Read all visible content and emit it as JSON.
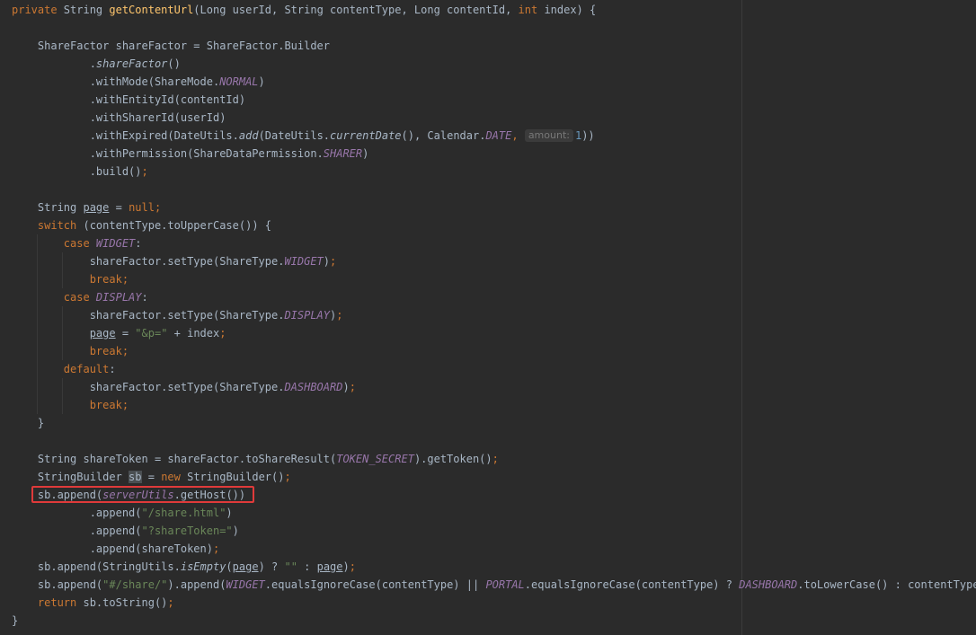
{
  "editor": {
    "theme_colors": {
      "background": "#2b2b2b",
      "keyword": "#cc7832",
      "method_declaration": "#ffc66d",
      "identifier": "#a9b7c6",
      "constant": "#9876aa",
      "string": "#6a8759",
      "number": "#6897bb",
      "highlight_box": "#e03a3a"
    },
    "highlighted_line": "sb.append(serverUtils.getHost())",
    "inlay_hint": "amount:",
    "lines": [
      [
        [
          "kw",
          "private "
        ],
        [
          "pl",
          "String "
        ],
        [
          "mt",
          "getContentUrl"
        ],
        [
          "pl",
          "(Long userId, String contentType, Long contentId, "
        ],
        [
          "kw",
          "int "
        ],
        [
          "pl",
          "index) {"
        ]
      ],
      [],
      [
        [
          "pl",
          "    ShareFactor shareFactor = ShareFactor."
        ],
        [
          "pl",
          "Builder"
        ]
      ],
      [
        [
          "pl",
          "            ."
        ],
        [
          "sc",
          "shareFactor"
        ],
        [
          "pl",
          "()"
        ]
      ],
      [
        [
          "pl",
          "            .withMode(ShareMode."
        ],
        [
          "st",
          "NORMAL"
        ],
        [
          "pl",
          ")"
        ]
      ],
      [
        [
          "pl",
          "            .withEntityId(contentId)"
        ]
      ],
      [
        [
          "pl",
          "            .withSharerId(userId)"
        ]
      ],
      [
        [
          "pl",
          "            .withExpired(DateUtils."
        ],
        [
          "sc",
          "add"
        ],
        [
          "pl",
          "(DateUtils."
        ],
        [
          "sc",
          "currentDate"
        ],
        [
          "pl",
          "(), Calendar."
        ],
        [
          "st",
          "DATE"
        ],
        [
          "pu",
          ", "
        ],
        [
          "hint",
          "amount:"
        ],
        [
          "nu",
          "1"
        ],
        [
          "pl",
          "))"
        ]
      ],
      [
        [
          "pl",
          "            .withPermission(ShareDataPermission."
        ],
        [
          "st",
          "SHARER"
        ],
        [
          "pl",
          ")"
        ]
      ],
      [
        [
          "pl",
          "            .build()"
        ],
        [
          "pu",
          ";"
        ]
      ],
      [],
      [
        [
          "pl",
          "    String "
        ],
        [
          "ul",
          "page"
        ],
        [
          "pl",
          " = "
        ],
        [
          "kw",
          "null"
        ],
        [
          "pu",
          ";"
        ]
      ],
      [
        [
          "kw",
          "    switch "
        ],
        [
          "pl",
          "(contentType.toUpperCase()) {"
        ]
      ],
      [
        [
          "kw",
          "        case "
        ],
        [
          "st",
          "WIDGET"
        ],
        [
          "pl",
          ":"
        ]
      ],
      [
        [
          "pl",
          "            shareFactor.setType(ShareType."
        ],
        [
          "st",
          "WIDGET"
        ],
        [
          "pl",
          ")"
        ],
        [
          "pu",
          ";"
        ]
      ],
      [
        [
          "kw",
          "            break"
        ],
        [
          "pu",
          ";"
        ]
      ],
      [
        [
          "kw",
          "        case "
        ],
        [
          "st",
          "DISPLAY"
        ],
        [
          "pl",
          ":"
        ]
      ],
      [
        [
          "pl",
          "            shareFactor.setType(ShareType."
        ],
        [
          "st",
          "DISPLAY"
        ],
        [
          "pl",
          ")"
        ],
        [
          "pu",
          ";"
        ]
      ],
      [
        [
          "pl",
          "            "
        ],
        [
          "ul",
          "page"
        ],
        [
          "pl",
          " = "
        ],
        [
          "sr",
          "\"&p=\""
        ],
        [
          "pl",
          " + index"
        ],
        [
          "pu",
          ";"
        ]
      ],
      [
        [
          "kw",
          "            break"
        ],
        [
          "pu",
          ";"
        ]
      ],
      [
        [
          "kw",
          "        default"
        ],
        [
          "pl",
          ":"
        ]
      ],
      [
        [
          "pl",
          "            shareFactor.setType(ShareType."
        ],
        [
          "st",
          "DASHBOARD"
        ],
        [
          "pl",
          ")"
        ],
        [
          "pu",
          ";"
        ]
      ],
      [
        [
          "kw",
          "            break"
        ],
        [
          "pu",
          ";"
        ]
      ],
      [
        [
          "pl",
          "    }"
        ]
      ],
      [],
      [
        [
          "pl",
          "    String shareToken = shareFactor.toShareResult("
        ],
        [
          "st",
          "TOKEN_SECRET"
        ],
        [
          "pl",
          ").getToken()"
        ],
        [
          "pu",
          ";"
        ]
      ],
      [
        [
          "pl",
          "    StringBuilder "
        ],
        [
          "hl",
          "sb"
        ],
        [
          "pl",
          " = "
        ],
        [
          "kw",
          "new "
        ],
        [
          "pl",
          "StringBuilder()"
        ],
        [
          "pu",
          ";"
        ]
      ],
      [
        [
          "pl",
          "    sb.append("
        ],
        [
          "st",
          "serverUtils"
        ],
        [
          "pl",
          ".getHost())"
        ]
      ],
      [
        [
          "pl",
          "            .append("
        ],
        [
          "sr",
          "\"/share.html\""
        ],
        [
          "pl",
          ")"
        ]
      ],
      [
        [
          "pl",
          "            .append("
        ],
        [
          "sr",
          "\"?shareToken=\""
        ],
        [
          "pl",
          ")"
        ]
      ],
      [
        [
          "pl",
          "            .append(shareToken)"
        ],
        [
          "pu",
          ";"
        ]
      ],
      [
        [
          "pl",
          "    sb.append(StringUtils."
        ],
        [
          "sc",
          "isEmpty"
        ],
        [
          "pl",
          "("
        ],
        [
          "ul",
          "page"
        ],
        [
          "pl",
          ") ? "
        ],
        [
          "sr",
          "\"\""
        ],
        [
          "pl",
          " : "
        ],
        [
          "ul",
          "page"
        ],
        [
          "pl",
          ")"
        ],
        [
          "pu",
          ";"
        ]
      ],
      [
        [
          "pl",
          "    sb.append("
        ],
        [
          "sr",
          "\"#/share/\""
        ],
        [
          "pl",
          ").append("
        ],
        [
          "st",
          "WIDGET"
        ],
        [
          "pl",
          ".equalsIgnoreCase(contentType) || "
        ],
        [
          "st",
          "PORTAL"
        ],
        [
          "pl",
          ".equalsIgnoreCase(contentType) ? "
        ],
        [
          "st",
          "DASHBOARD"
        ],
        [
          "pl",
          ".toLowerCase() : contentType)"
        ],
        [
          "pu",
          ";"
        ]
      ],
      [
        [
          "kw",
          "    return "
        ],
        [
          "pl",
          "sb.toString()"
        ],
        [
          "pu",
          ";"
        ]
      ],
      [
        [
          "pl",
          "}"
        ]
      ]
    ]
  }
}
